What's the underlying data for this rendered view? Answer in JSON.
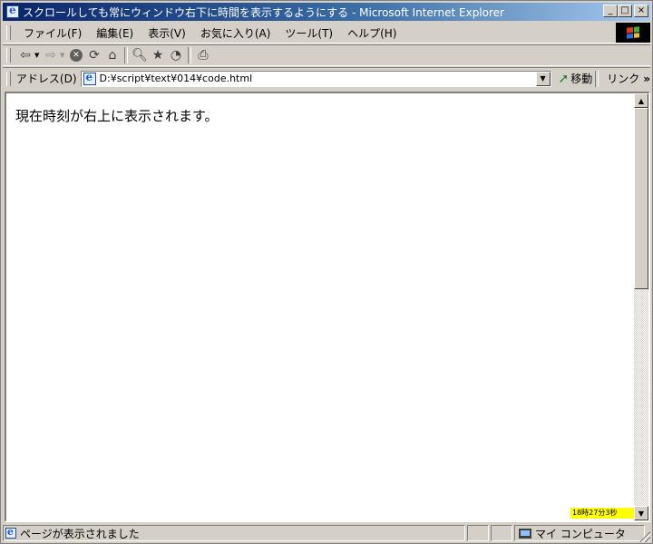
{
  "window": {
    "title": "スクロールしても常にウィンドウ右下に時間を表示するようにする - Microsoft Internet Explorer",
    "buttons": {
      "minimize": "_",
      "maximize": "□",
      "close": "×"
    }
  },
  "menu": {
    "items": [
      "ファイル(F)",
      "編集(E)",
      "表示(V)",
      "お気に入り(A)",
      "ツール(T)",
      "ヘルプ(H)"
    ]
  },
  "toolbar": {
    "icons": [
      "back-arrow-icon",
      "forward-arrow-icon",
      "stop-icon",
      "refresh-icon",
      "home-icon",
      "search-icon",
      "favorites-icon",
      "history-icon",
      "print-icon"
    ]
  },
  "address": {
    "label": "アドレス(D)",
    "value": "D:¥script¥text¥014¥code.html",
    "go_label": "移動",
    "links_label": "リンク"
  },
  "page": {
    "text": "現在時刻が右上に表示されます。",
    "clock": "18時27分3秒"
  },
  "status": {
    "message": "ページが表示されました",
    "zone": "マイ コンピュータ"
  },
  "colors": {
    "title_bar_start": "#0a246a",
    "title_bar_end": "#a6caf0",
    "clock_bg": "#ffff00",
    "chrome": "#d4d0c8"
  }
}
